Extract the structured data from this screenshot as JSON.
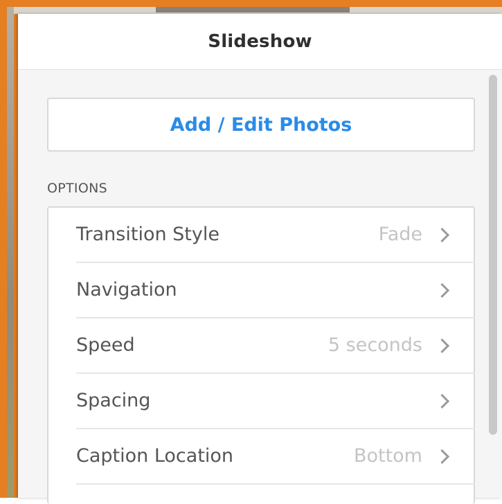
{
  "panel": {
    "title": "Slideshow"
  },
  "add_edit_button": {
    "label": "Add / Edit Photos"
  },
  "options": {
    "section_label": "OPTIONS",
    "items": [
      {
        "label": "Transition Style",
        "value": "Fade",
        "icon": "chevron-right-icon"
      },
      {
        "label": "Navigation",
        "value": "",
        "icon": "chevron-right-icon"
      },
      {
        "label": "Speed",
        "value": "5 seconds",
        "icon": "chevron-right-icon"
      },
      {
        "label": "Spacing",
        "value": "",
        "icon": "chevron-right-icon"
      },
      {
        "label": "Caption Location",
        "value": "Bottom",
        "icon": "chevron-right-icon"
      }
    ]
  },
  "colors": {
    "accent": "#2a8be8",
    "highlight_frame": "#e67e22",
    "label_text": "#555555",
    "value_text": "#c4c4c4"
  }
}
